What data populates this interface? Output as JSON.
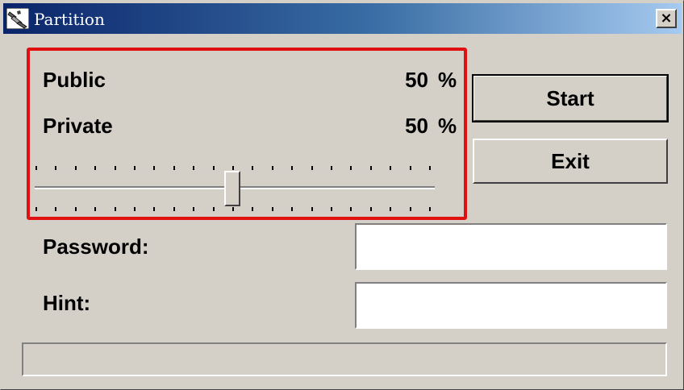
{
  "window": {
    "title": "Partition",
    "close_label": "×"
  },
  "partition": {
    "public_label": "Public",
    "public_value": "50",
    "private_label": "Private",
    "private_value": "50",
    "percent_sign": "%",
    "slider_percent": 50,
    "highlight_color": "#e01010"
  },
  "buttons": {
    "start_label": "Start",
    "exit_label": "Exit"
  },
  "password": {
    "label": "Password:",
    "value": ""
  },
  "hint": {
    "label": "Hint:",
    "value": ""
  },
  "progress": {
    "percent": 0
  },
  "icons": {
    "app": "partition-app-icon",
    "close": "close-icon"
  }
}
